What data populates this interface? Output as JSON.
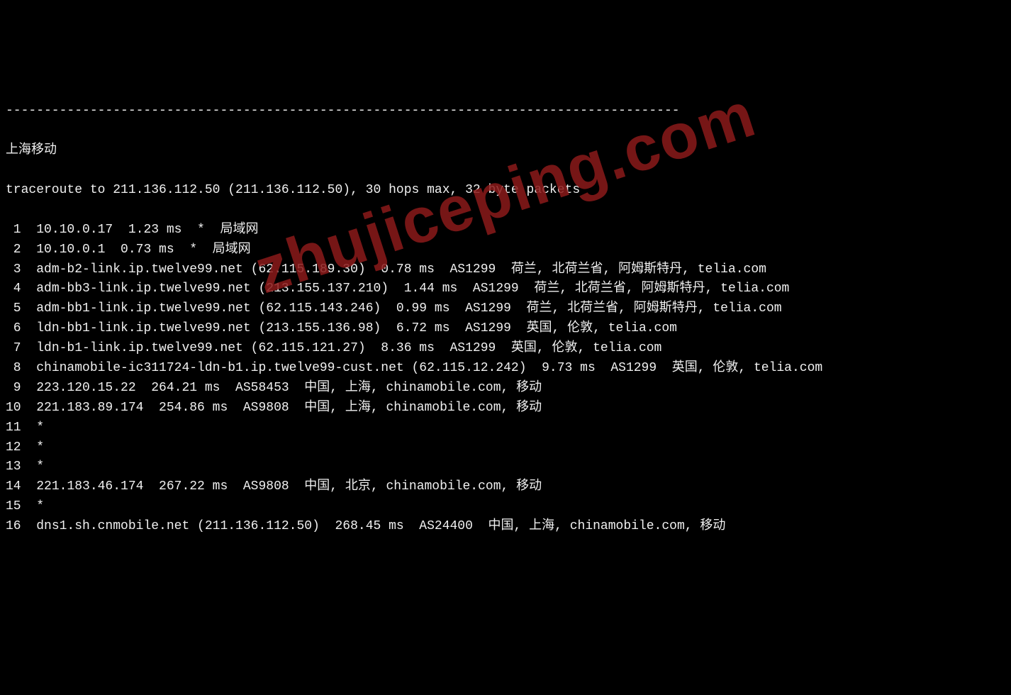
{
  "separator": "----------------------------------------------------------------------------------------",
  "title": "上海移动",
  "header": "traceroute to 211.136.112.50 (211.136.112.50), 30 hops max, 32 byte packets",
  "watermark": "zhujiceping.com",
  "hops": [
    {
      "num": " 1",
      "text": "  10.10.0.17  1.23 ms  *  局域网"
    },
    {
      "num": " 2",
      "text": "  10.10.0.1  0.73 ms  *  局域网"
    },
    {
      "num": " 3",
      "text": "  adm-b2-link.ip.twelve99.net (62.115.189.30)  0.78 ms  AS1299  荷兰, 北荷兰省, 阿姆斯特丹, telia.com"
    },
    {
      "num": " 4",
      "text": "  adm-bb3-link.ip.twelve99.net (213.155.137.210)  1.44 ms  AS1299  荷兰, 北荷兰省, 阿姆斯特丹, telia.com"
    },
    {
      "num": " 5",
      "text": "  adm-bb1-link.ip.twelve99.net (62.115.143.246)  0.99 ms  AS1299  荷兰, 北荷兰省, 阿姆斯特丹, telia.com"
    },
    {
      "num": " 6",
      "text": "  ldn-bb1-link.ip.twelve99.net (213.155.136.98)  6.72 ms  AS1299  英国, 伦敦, telia.com"
    },
    {
      "num": " 7",
      "text": "  ldn-b1-link.ip.twelve99.net (62.115.121.27)  8.36 ms  AS1299  英国, 伦敦, telia.com"
    },
    {
      "num": " 8",
      "text": "  chinamobile-ic311724-ldn-b1.ip.twelve99-cust.net (62.115.12.242)  9.73 ms  AS1299  英国, 伦敦, telia.com"
    },
    {
      "num": " 9",
      "text": "  223.120.15.22  264.21 ms  AS58453  中国, 上海, chinamobile.com, 移动"
    },
    {
      "num": "10",
      "text": "  221.183.89.174  254.86 ms  AS9808  中国, 上海, chinamobile.com, 移动"
    },
    {
      "num": "11",
      "text": "  *"
    },
    {
      "num": "12",
      "text": "  *"
    },
    {
      "num": "13",
      "text": "  *"
    },
    {
      "num": "14",
      "text": "  221.183.46.174  267.22 ms  AS9808  中国, 北京, chinamobile.com, 移动"
    },
    {
      "num": "15",
      "text": "  *"
    },
    {
      "num": "16",
      "text": "  dns1.sh.cnmobile.net (211.136.112.50)  268.45 ms  AS24400  中国, 上海, chinamobile.com, 移动"
    }
  ]
}
